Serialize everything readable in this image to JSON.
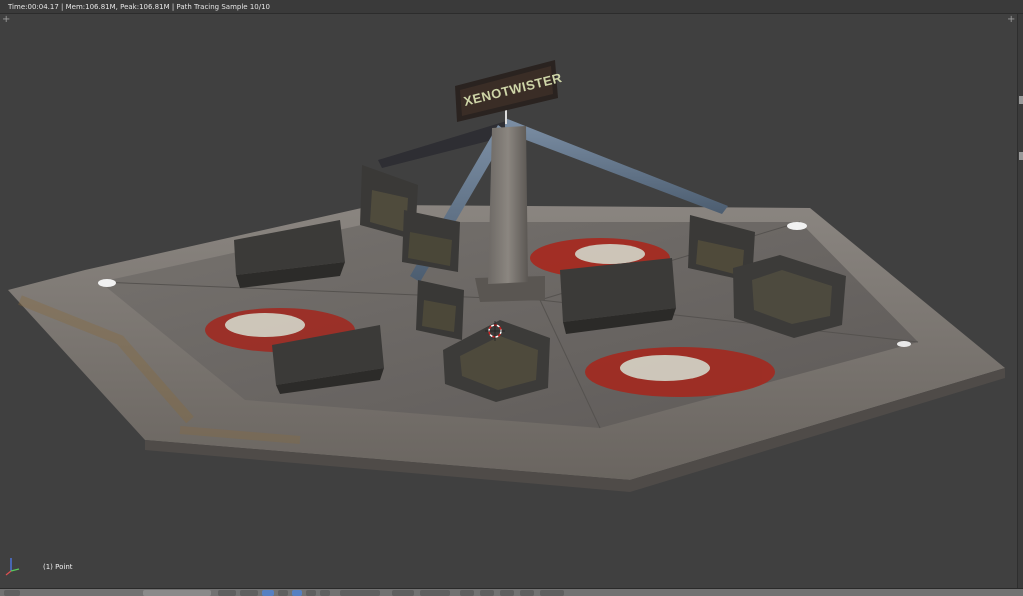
{
  "status": {
    "render_info": "Time:00:04.17 | Mem:106.81M, Peak:106.81M | Path Tracing Sample 10/10"
  },
  "viewport": {
    "object_label": "(1) Point",
    "ride_sign_text": "XENOTWISTER"
  },
  "icons": {
    "gizmo": "axis-gizmo-icon",
    "cursor": "3d-cursor-icon",
    "corner": "plus-icon"
  },
  "colors": {
    "viewport_bg": "#404040",
    "status_bg": "#3a3a3a",
    "header_bg": "#727272",
    "accent_blue": "#5680c2",
    "sign_text": "#cfd6a8"
  }
}
